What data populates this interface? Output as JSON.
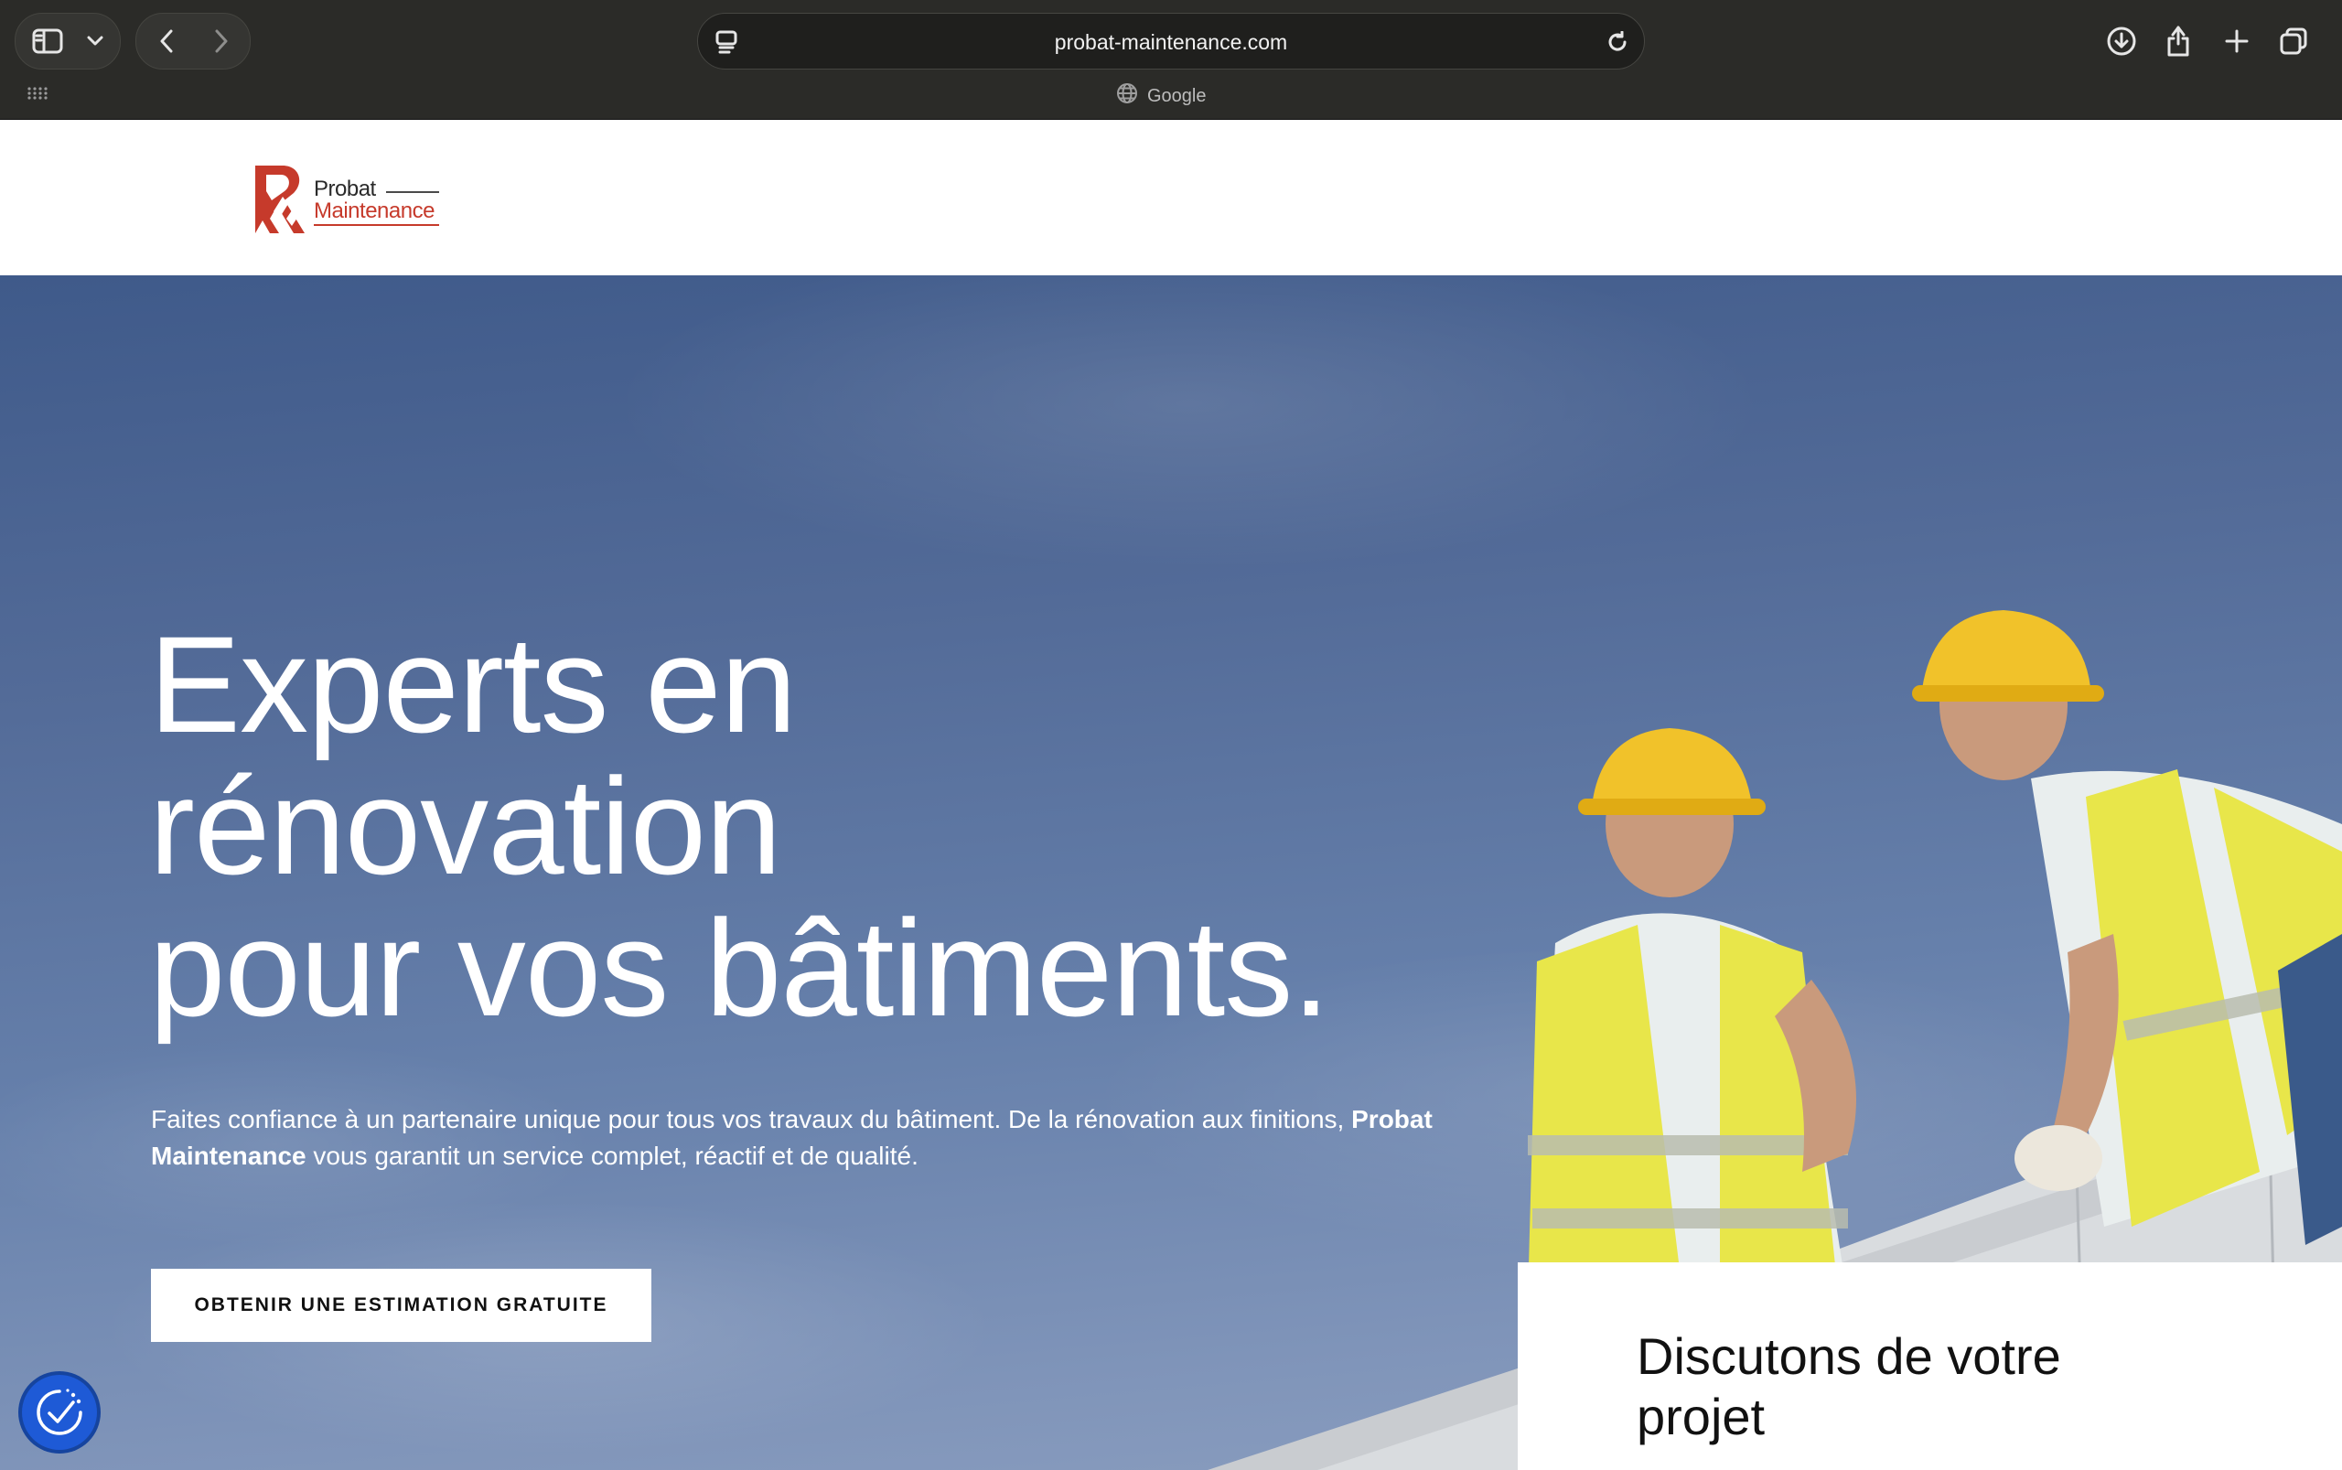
{
  "browser": {
    "url": "probat-maintenance.com",
    "favorites_tab_label": "Google",
    "icons": {
      "sidebar": "sidebar-icon",
      "dropdown": "chevron-down-icon",
      "back": "chevron-left-icon",
      "forward": "chevron-right-icon",
      "reader": "reader-icon",
      "reload": "reload-icon",
      "download": "download-icon",
      "share": "share-icon",
      "new_tab": "plus-icon",
      "tabs": "tabs-overview-icon",
      "apps": "grid-icon",
      "globe": "globe-icon"
    }
  },
  "header": {
    "logo_line1": "Probat",
    "logo_line2": "Maintenance",
    "brand_color": "#c63a2b"
  },
  "hero": {
    "title_line1": "Experts en",
    "title_line2": "rénovation",
    "title_line3": "pour vos bâtiments.",
    "subtitle_part1": "Faites confiance à un partenaire unique pour tous vos travaux du bâtiment. De la rénovation aux finitions, ",
    "subtitle_bold": "Probat Maintenance",
    "subtitle_part2": " vous garantit un service complet, réactif et de qualité.",
    "cta_label": "OBTENIR UNE ESTIMATION GRATUITE"
  },
  "contact_card": {
    "title": "Discutons de votre projet"
  },
  "accessibility": {
    "icon": "accessibility-icon",
    "color": "#1e5ad6"
  }
}
